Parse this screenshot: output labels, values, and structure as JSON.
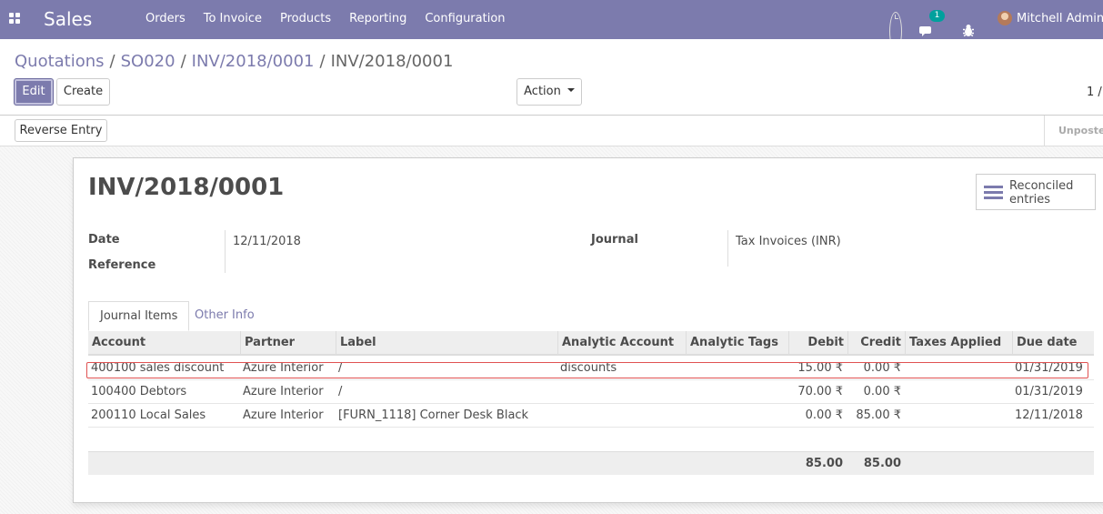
{
  "navbar": {
    "brand": "Sales",
    "menu": [
      "Orders",
      "To Invoice",
      "Products",
      "Reporting",
      "Configuration"
    ],
    "chat_count": "1",
    "user": "Mitchell Admin (",
    "icons": [
      "apps-icon",
      "clock-icon",
      "chat-icon",
      "bug-icon"
    ]
  },
  "breadcrumb": {
    "items": [
      "Quotations",
      "SO020",
      "INV/2018/0001"
    ],
    "current": "INV/2018/0001"
  },
  "buttons": {
    "edit": "Edit",
    "create": "Create",
    "action": "Action",
    "reverse": "Reverse Entry"
  },
  "pager": "1 /",
  "status": "Unposted",
  "record": {
    "title": "INV/2018/0001",
    "smart_button": "Reconciled entries",
    "date_label": "Date",
    "date_value": "12/11/2018",
    "reference_label": "Reference",
    "journal_label": "Journal",
    "journal_value": "Tax Invoices (INR)"
  },
  "tabs": [
    "Journal Items",
    "Other Info"
  ],
  "table": {
    "headers": [
      "Account",
      "Partner",
      "Label",
      "Analytic Account",
      "Analytic Tags",
      "Debit",
      "Credit",
      "Taxes Applied",
      "Due date"
    ],
    "rows": [
      [
        "400100 sales discount",
        "Azure Interior",
        "/",
        "discounts",
        "",
        "15.00 ₹",
        "0.00 ₹",
        "",
        "01/31/2019"
      ],
      [
        "100400 Debtors",
        "Azure Interior",
        "/",
        "",
        "",
        "70.00 ₹",
        "0.00 ₹",
        "",
        "01/31/2019"
      ],
      [
        "200110 Local Sales",
        "Azure Interior",
        "[FURN_1118] Corner Desk Black",
        "",
        "",
        "0.00 ₹",
        "85.00 ₹",
        "",
        "12/11/2018"
      ]
    ],
    "totals": {
      "debit": "85.00",
      "credit": "85.00"
    }
  },
  "colors": {
    "brand": "#7c7bad",
    "badge": "#00a09d",
    "highlight": "#e05252"
  }
}
